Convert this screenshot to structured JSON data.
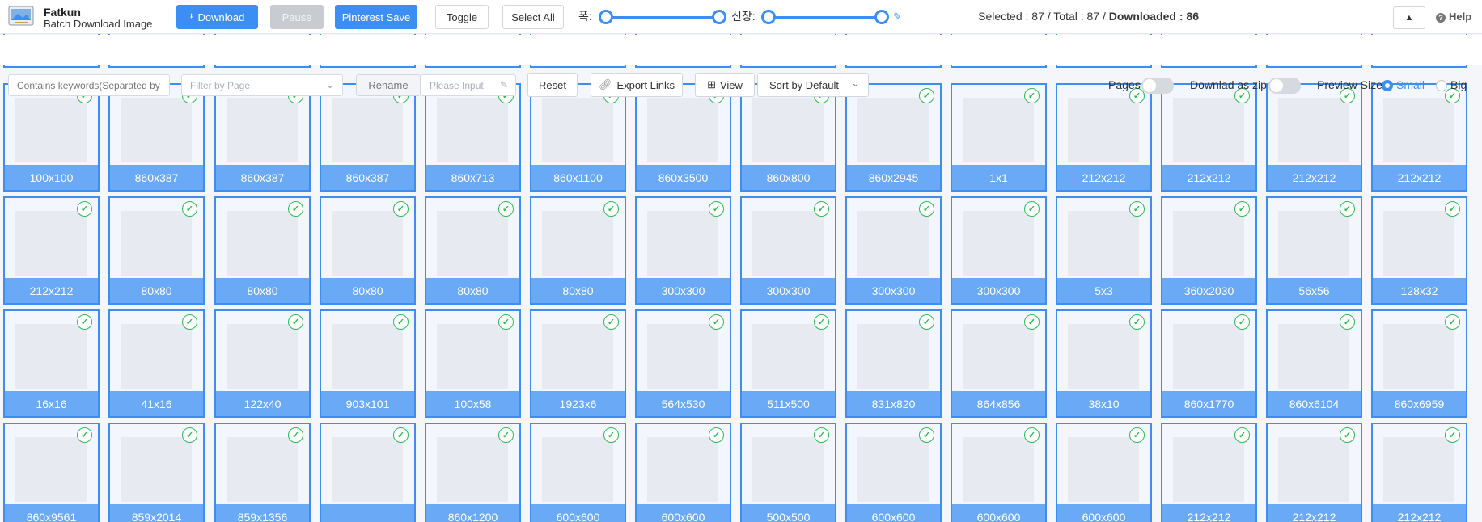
{
  "app": {
    "name": "Fatkun",
    "subtitle": "Batch Download Image"
  },
  "toolbar": {
    "download": "Download",
    "pause": "Pause",
    "pinterest": "Pinterest Save",
    "toggle": "Toggle",
    "select_all": "Select All",
    "width_label": "폭:",
    "height_label": "신장:",
    "selected_label": "Selected : 87 / Total : 87 / ",
    "downloaded": "Downloaded : 86",
    "help": "Help"
  },
  "filters": {
    "keywords_placeholder": "Contains keywords(Separated by c",
    "page_filter": "Filter by Page",
    "rename": "Rename",
    "rename_input": "Please Input",
    "reset": "Reset",
    "export": "Export Links",
    "view": "View",
    "sort": "Sort by Default",
    "pages": "Pages",
    "zip": "Downlad as zip",
    "preview": "Preview Size",
    "small": "Small",
    "big": "Big"
  },
  "accent": "#3d8ef4",
  "tiles": [
    "100x100",
    "860x387",
    "860x387",
    "860x387",
    "860x713",
    "860x1100",
    "860x3500",
    "860x800",
    "860x2945",
    "1x1",
    "212x212",
    "212x212",
    "212x212",
    "212x212",
    "212x212",
    "80x80",
    "80x80",
    "80x80",
    "80x80",
    "80x80",
    "300x300",
    "300x300",
    "300x300",
    "300x300",
    "5x3",
    "360x2030",
    "56x56",
    "128x32",
    "16x16",
    "41x16",
    "122x40",
    "903x101",
    "100x58",
    "1923x6",
    "564x530",
    "511x500",
    "831x820",
    "864x856",
    "38x10",
    "860x1770",
    "860x6104",
    "860x6959",
    "860x9561",
    "859x2014",
    "859x1356",
    "",
    "860x1200",
    "600x600",
    "600x600",
    "500x500",
    "600x600",
    "600x600",
    "600x600",
    "212x212",
    "212x212",
    "212x212"
  ]
}
